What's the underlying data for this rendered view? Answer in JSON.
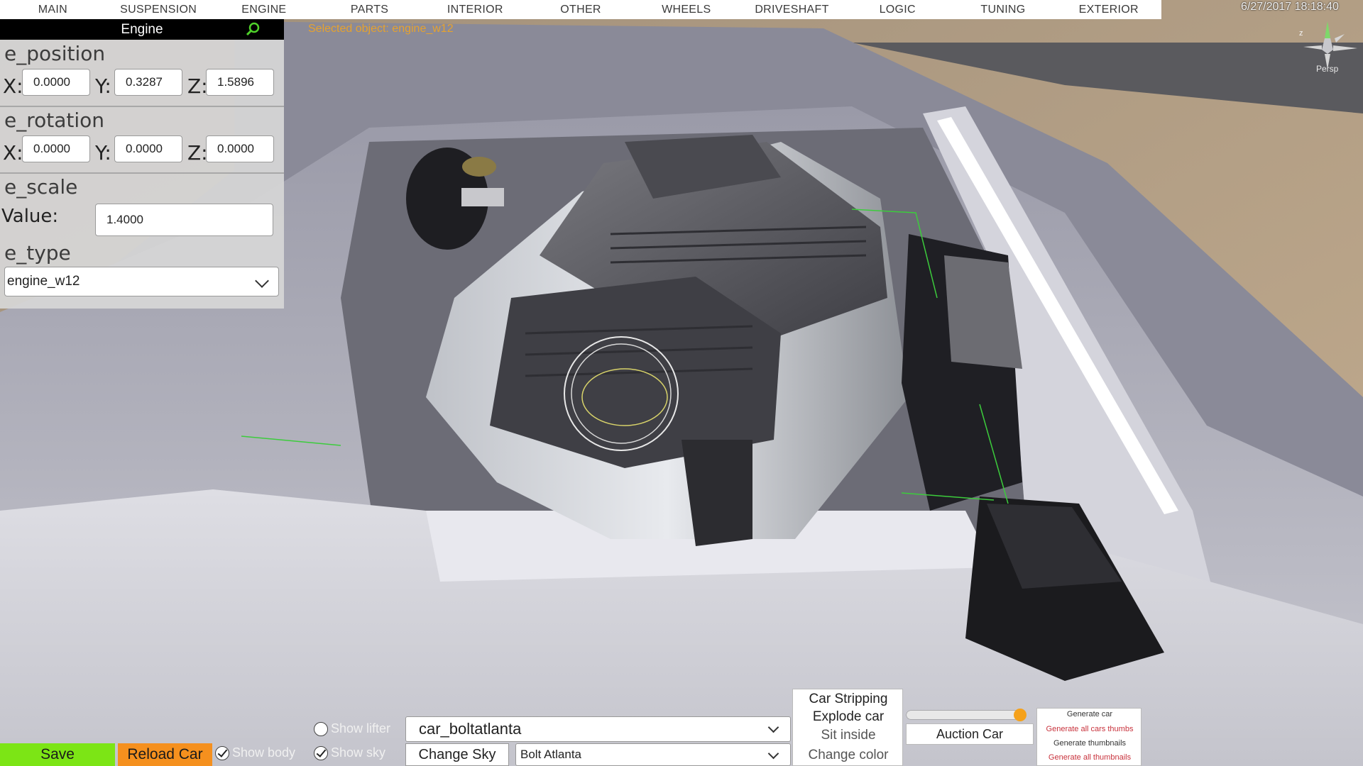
{
  "top_menu": {
    "items": [
      "MAIN",
      "SUSPENSION",
      "ENGINE",
      "PARTS",
      "INTERIOR",
      "OTHER",
      "WHEELS",
      "DRIVESHAFT",
      "LOGIC",
      "TUNING",
      "EXTERIOR"
    ]
  },
  "status": {
    "datetime": "6/27/2017 18:18:40",
    "selected_object": "Selected object: engine_w12",
    "gizmo_axis_label": "z",
    "view_mode": "Persp"
  },
  "inspector": {
    "title": "Engine",
    "position": {
      "label": "e_position",
      "x_label": "X:",
      "y_label": "Y:",
      "z_label": "Z:",
      "x": "0.0000",
      "y": "0.3287",
      "z": "1.5896"
    },
    "rotation": {
      "label": "e_rotation",
      "x_label": "X:",
      "y_label": "Y:",
      "z_label": "Z:",
      "x": "0.0000",
      "y": "0.0000",
      "z": "0.0000"
    },
    "scale": {
      "label": "e_scale",
      "value_label": "Value:",
      "value": "1.4000"
    },
    "type": {
      "label": "e_type",
      "selected": "engine_w12"
    }
  },
  "toolbar": {
    "save": "Save",
    "reload_car": "Reload Car",
    "show_body": "Show body",
    "show_lifter": "Show lifter",
    "show_sky": "Show sky",
    "car_select": "car_boltatlanta",
    "change_sky": "Change Sky",
    "sky_select": "Bolt Atlanta",
    "actions": {
      "car_stripping": "Car Stripping",
      "explode_car": "Explode car",
      "sit_inside": "Sit inside",
      "change_color": "Change color"
    },
    "auction_car": "Auction Car",
    "auction_slider_value": 1.0,
    "generate": {
      "generate_car": "Generate car",
      "generate_all_cars_thumbs": "Generate all cars thumbs",
      "generate_thumbnails": "Generate thumbnails",
      "generate_all_thumbnails": "Generate all thumbnails"
    }
  },
  "colors": {
    "save": "#7ce515",
    "reload": "#f5901e",
    "selected_object_text": "#e6a22e",
    "slider_knob": "#f5a11a",
    "generate_red": "#c8323c"
  }
}
